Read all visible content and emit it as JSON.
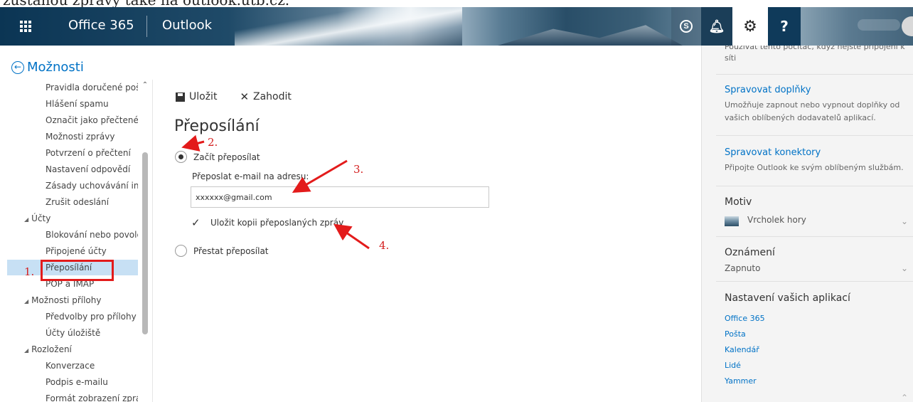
{
  "caption": "zůstanou zprávy také na outlook.utb.cz.",
  "header": {
    "brand": "Office 365",
    "app": "Outlook",
    "skype_glyph": "S",
    "help_glyph": "?"
  },
  "nav": {
    "back_label": "Možnosti",
    "items": [
      {
        "label": "Pravidla doručené pošt",
        "level": 2
      },
      {
        "label": "Hlášení spamu",
        "level": 2
      },
      {
        "label": "Označit jako přečtené",
        "level": 2
      },
      {
        "label": "Možnosti zprávy",
        "level": 2
      },
      {
        "label": "Potvrzení o přečtení",
        "level": 2
      },
      {
        "label": "Nastavení odpovědí",
        "level": 2
      },
      {
        "label": "Zásady uchovávání infor",
        "level": 2
      },
      {
        "label": "Zrušit odeslání",
        "level": 2
      },
      {
        "label": "Účty",
        "level": 1
      },
      {
        "label": "Blokování nebo povolení",
        "level": 2
      },
      {
        "label": "Připojené účty",
        "level": 2
      },
      {
        "label": "Přeposílání",
        "level": 2,
        "selected": true
      },
      {
        "label": "POP a IMAP",
        "level": 2
      },
      {
        "label": "Možnosti přílohy",
        "level": 1
      },
      {
        "label": "Předvolby pro přílohy",
        "level": 2
      },
      {
        "label": "Účty úložiště",
        "level": 2
      },
      {
        "label": "Rozložení",
        "level": 1
      },
      {
        "label": "Konverzace",
        "level": 2
      },
      {
        "label": "Podpis e-mailu",
        "level": 2
      },
      {
        "label": "Formát zobrazení zpráv",
        "level": 2
      }
    ]
  },
  "annotations": {
    "a1": "1.",
    "a2": "2.",
    "a3": "3.",
    "a4": "4."
  },
  "toolbar": {
    "save_label": "Uložit",
    "discard_label": "Zahodit"
  },
  "forwarding": {
    "title": "Přeposílání",
    "start_label": "Začít přeposílat",
    "address_label": "Přeposlat e-mail na adresu:",
    "address_value": "xxxxxx@gmail.com",
    "keep_copy_label": "Uložit kopii přeposlaných zpráv",
    "keep_copy_checked": true,
    "stop_label": "Přestat přeposílat",
    "selected": "start"
  },
  "right_panel": {
    "clipped_text": "Používat tento počítač, když nejste připojeni k síti",
    "addins_link": "Spravovat doplňky",
    "addins_desc": "Umožňuje zapnout nebo vypnout doplňky od vašich oblíbených dodavatelů aplikací.",
    "connectors_link": "Spravovat konektory",
    "connectors_desc": "Připojte Outlook ke svým oblíbeným službám.",
    "theme_heading": "Motiv",
    "theme_value": "Vrcholek hory",
    "notif_heading": "Oznámení",
    "notif_value": "Zapnuto",
    "apps_heading": "Nastavení vašich aplikací",
    "apps": [
      "Office 365",
      "Pošta",
      "Kalendář",
      "Lidé",
      "Yammer"
    ]
  },
  "icons": {
    "app_launcher": "waffle-icon",
    "back": "back-arrow-circle-icon",
    "save": "floppy-disk-icon",
    "discard": "x-icon",
    "settings": "gear-icon",
    "notifications": "bell-icon"
  },
  "colors": {
    "accent": "#0072c6",
    "selection": "#c7e0f4",
    "annotation": "#e31b1b"
  }
}
